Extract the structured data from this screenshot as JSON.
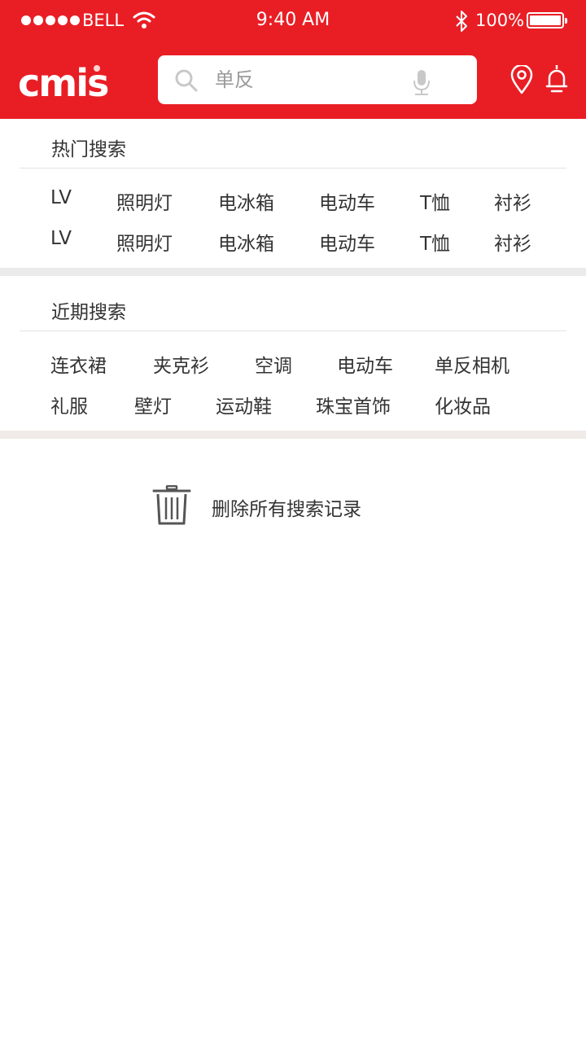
{
  "status_bar": {
    "carrier": "BELL",
    "time": "9:40 AM",
    "battery": "100%"
  },
  "header": {
    "logo_text": "cmis",
    "search": {
      "value": "",
      "placeholder": "单反"
    },
    "colors": {
      "brand": "#e91e25"
    }
  },
  "hot_search": {
    "title": "热门搜索",
    "rows": [
      [
        "LV",
        "照明灯",
        "电冰箱",
        "电动车",
        "T恤",
        "衬衫"
      ],
      [
        "LV",
        "照明灯",
        "电冰箱",
        "电动车",
        "T恤",
        "衬衫"
      ]
    ]
  },
  "recent_search": {
    "title": "近期搜索",
    "rows": [
      [
        "连衣裙",
        "夹克衫",
        "空调",
        "电动车",
        "单反相机"
      ],
      [
        "礼服",
        "壁灯",
        "运动鞋",
        "珠宝首饰",
        "化妆品"
      ]
    ]
  },
  "actions": {
    "delete_all_label": "删除所有搜索记录"
  },
  "icons": [
    "signal-dots",
    "wifi-icon",
    "bluetooth-icon",
    "battery-icon",
    "search-icon",
    "microphone-icon",
    "location-pin-icon",
    "bell-icon",
    "trash-icon"
  ]
}
